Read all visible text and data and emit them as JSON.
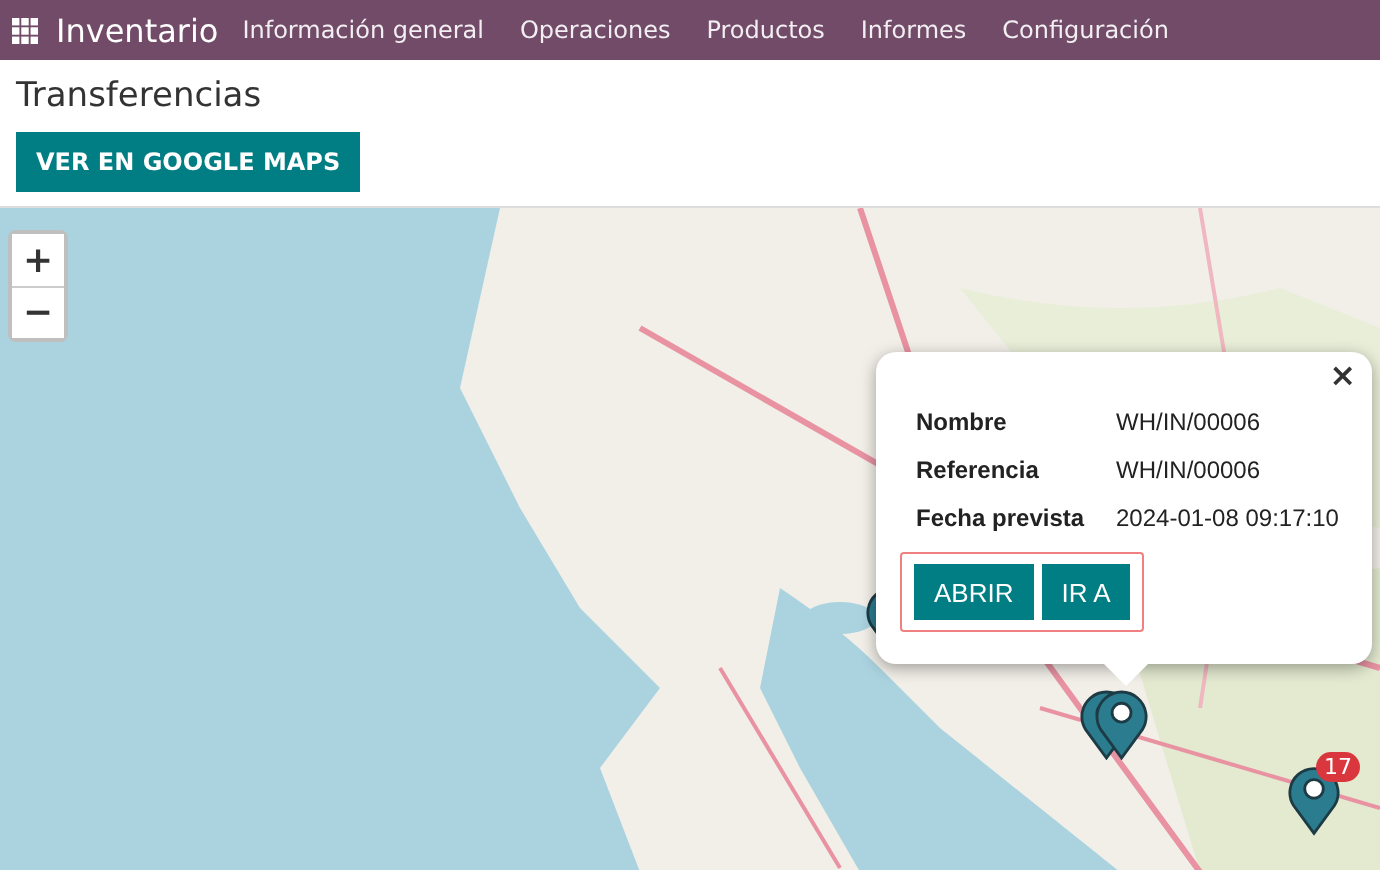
{
  "navbar": {
    "app": "Inventario",
    "menu": [
      "Información general",
      "Operaciones",
      "Productos",
      "Informes",
      "Configuración"
    ]
  },
  "page": {
    "title": "Transferencias",
    "button": "VER EN GOOGLE MAPS"
  },
  "map": {
    "zoom_in": "+",
    "zoom_out": "−",
    "markers": [
      {
        "kind": "pin"
      },
      {
        "kind": "pair"
      },
      {
        "kind": "pin",
        "badge": "17"
      }
    ],
    "popup": {
      "close": "×",
      "fields": [
        {
          "label": "Nombre",
          "value": "WH/IN/00006"
        },
        {
          "label": "Referencia",
          "value": "WH/IN/00006"
        },
        {
          "label": "Fecha prevista",
          "value": "2024-01-08 09:17:10"
        }
      ],
      "buttons": [
        "ABRIR",
        "IR A"
      ]
    }
  }
}
